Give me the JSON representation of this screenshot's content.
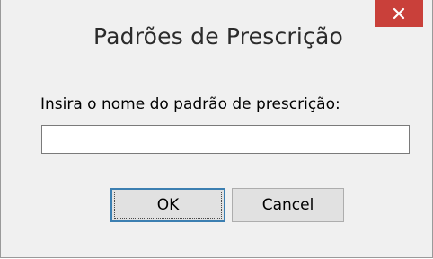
{
  "window": {
    "title": "Padrões de Prescrição",
    "close_glyph": "×"
  },
  "dialog": {
    "prompt": "Insira o nome do padrão de prescrição:",
    "input_value": "",
    "ok_label": "OK",
    "cancel_label": "Cancel"
  },
  "colors": {
    "close_button": "#c9403a",
    "background": "#f0f0f0",
    "focus_border": "#3c7fb1"
  },
  "icons": {
    "close": "close-icon"
  }
}
